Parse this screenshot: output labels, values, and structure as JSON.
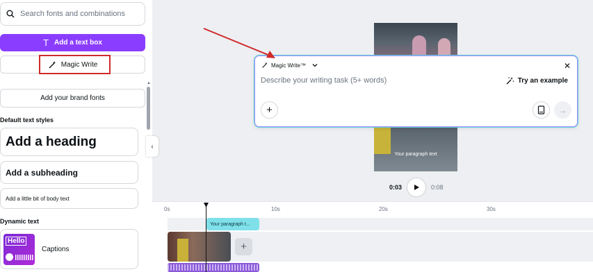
{
  "search": {
    "placeholder": "Search fonts and combinations"
  },
  "buttons": {
    "add_text_box": "Add a text box",
    "magic_write": "Magic Write",
    "brand_fonts": "Add your brand fonts"
  },
  "sections": {
    "default_styles": "Default text styles",
    "dynamic_text": "Dynamic text"
  },
  "styles": {
    "heading": "Add a heading",
    "subheading": "Add a subheading",
    "body": "Add a little bit of body text"
  },
  "captions": {
    "thumb_text": "Hello",
    "label": "Captions"
  },
  "canvas": {
    "paragraph_text": "Your paragraph text"
  },
  "popup": {
    "title": "Magic Write™",
    "prompt_placeholder": "Describe your writing task (5+ words)",
    "try_example": "Try an example"
  },
  "playback": {
    "current": "0:03",
    "duration": "0:08"
  },
  "timeline": {
    "ticks": [
      "0s",
      "10s",
      "20s",
      "30s"
    ],
    "text_clip": "Your paragraph t..."
  },
  "colors": {
    "accent": "#8b3dff",
    "highlight": "#d02a2a",
    "text_clip": "#7fe0ea"
  }
}
